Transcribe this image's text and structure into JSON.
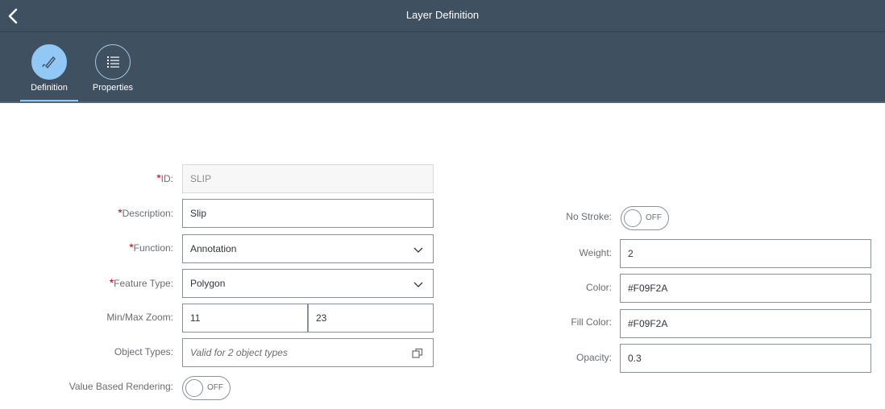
{
  "header": {
    "title": "Layer Definition"
  },
  "tabs": [
    {
      "label": "Definition",
      "icon": "pencil-icon",
      "selected": true
    },
    {
      "label": "Properties",
      "icon": "list-icon",
      "selected": false
    }
  ],
  "form_left": {
    "id": {
      "label": "ID:",
      "required_mark": "*",
      "value": "SLIP"
    },
    "description": {
      "label": "Description:",
      "required_mark": "*",
      "value": "Slip"
    },
    "function": {
      "label": "Function:",
      "required_mark": "*",
      "value": "Annotation"
    },
    "feature_type": {
      "label": "Feature Type:",
      "required_mark": "*",
      "value": "Polygon"
    },
    "zoom": {
      "label": "Min/Max Zoom:",
      "min": "11",
      "max": "23"
    },
    "object_types": {
      "label": "Object Types:",
      "placeholder": "Valid for 2 object types"
    },
    "value_based_rendering": {
      "label": "Value Based Rendering:",
      "state": "OFF"
    }
  },
  "form_right": {
    "no_stroke": {
      "label": "No Stroke:",
      "state": "OFF"
    },
    "weight": {
      "label": "Weight:",
      "value": "2"
    },
    "color": {
      "label": "Color:",
      "value": "#F09F2A"
    },
    "fill_color": {
      "label": "Fill Color:",
      "value": "#F09F2A"
    },
    "opacity": {
      "label": "Opacity:",
      "value": "0.3"
    }
  },
  "colors": {
    "header_bg": "#3f5161",
    "accent": "#91c8f6",
    "required": "#bb0000"
  }
}
